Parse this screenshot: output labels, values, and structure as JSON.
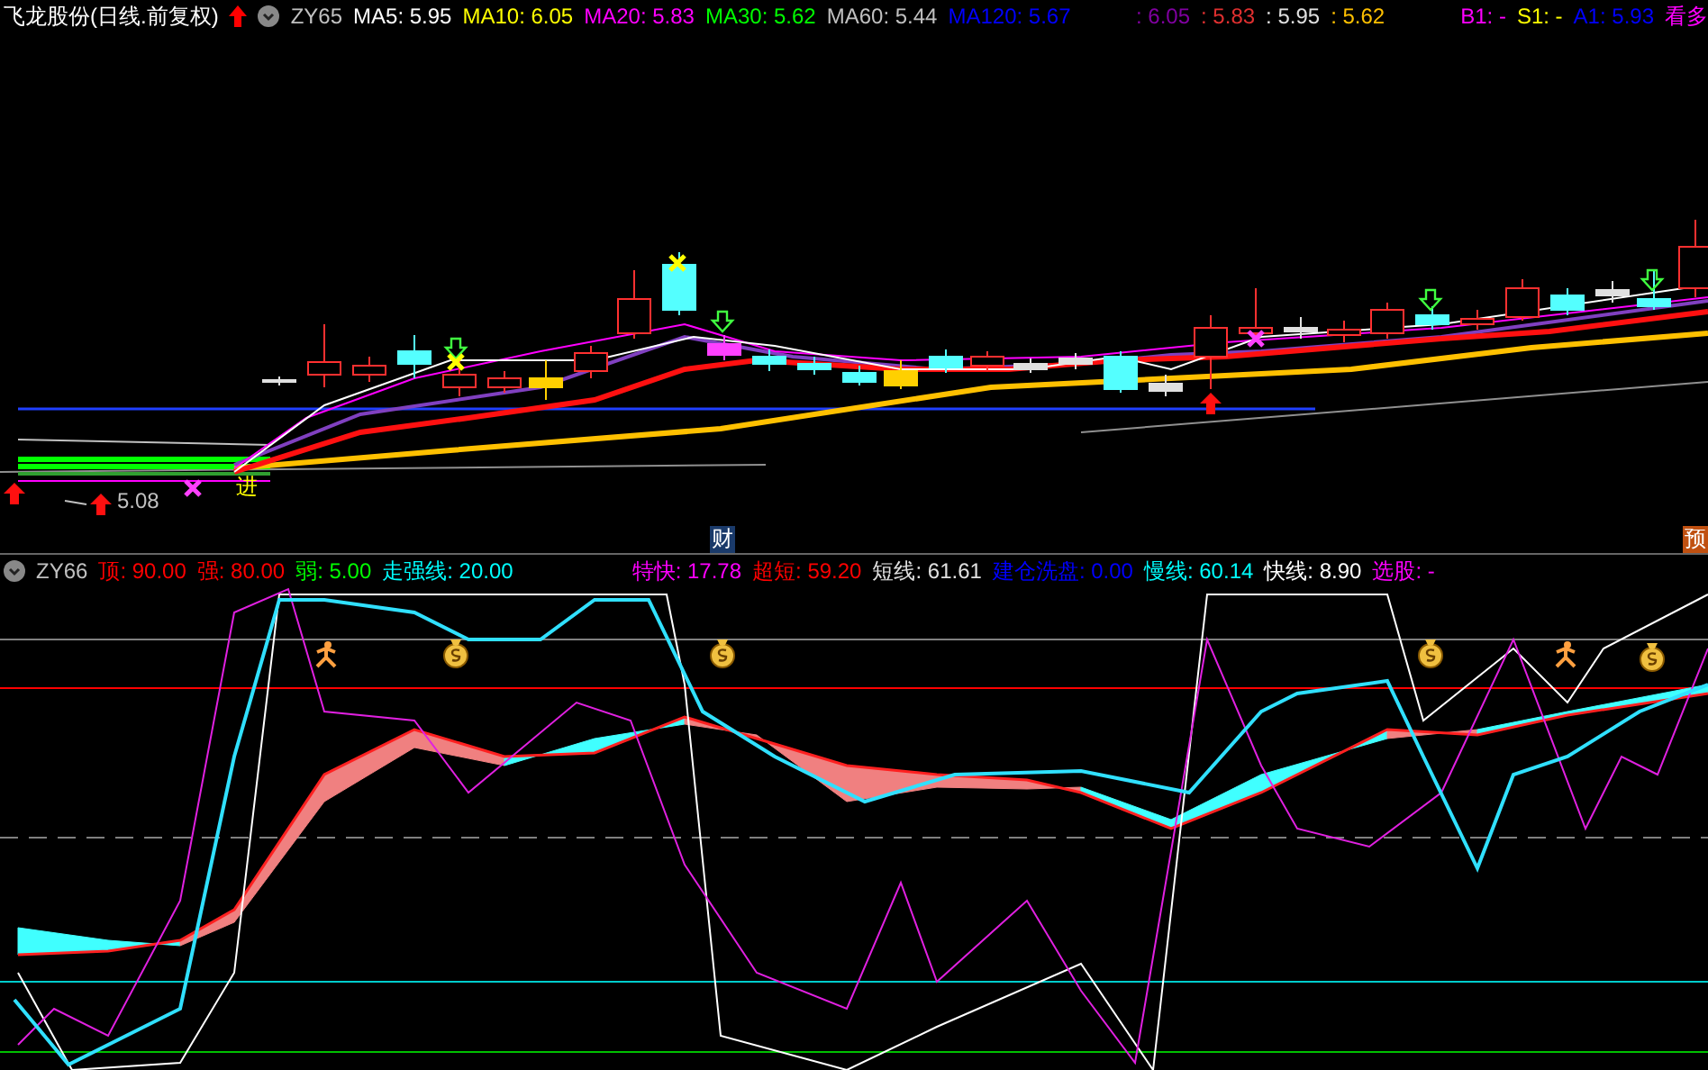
{
  "title": "飞龙股份(日线.前复权)",
  "top_indicator": {
    "name": "ZY65",
    "values": [
      {
        "text": "MA5: 5.95",
        "color": "#ffffff"
      },
      {
        "text": "MA10: 6.05",
        "color": "#ffff00"
      },
      {
        "text": "MA20: 5.83",
        "color": "#ff00ff"
      },
      {
        "text": "MA30: 5.62",
        "color": "#00ff00"
      },
      {
        "text": "MA60: 5.44",
        "color": "#c0c0c0"
      },
      {
        "text": "MA120: 5.67",
        "color": "#0000ff"
      }
    ],
    "extra_values": [
      {
        "text": ": 6.05",
        "color": "#8000a0"
      },
      {
        "text": ": 5.83",
        "color": "#e03030"
      },
      {
        "text": ": 5.95",
        "color": "#e0e0e0"
      },
      {
        "text": ": 5.62",
        "color": "#ffc000"
      }
    ],
    "signals": [
      {
        "text": "B1: -",
        "color": "#ff00ff"
      },
      {
        "text": "S1: -",
        "color": "#ffff00"
      },
      {
        "text": "A1: 5.93",
        "color": "#0000ff"
      },
      {
        "text": "看多",
        "color": "#ff00ff"
      }
    ]
  },
  "price_chart": {
    "low_label": "5.08",
    "entry_label": "进"
  },
  "event_markers": [
    {
      "text": "财",
      "kind": "finance"
    },
    {
      "text": "预",
      "kind": "forecast"
    }
  ],
  "bottom_indicator": {
    "name": "ZY66",
    "values": [
      {
        "text": "顶: 90.00",
        "color": "#ff0000"
      },
      {
        "text": "强: 80.00",
        "color": "#ff0000"
      },
      {
        "text": "弱: 5.00",
        "color": "#00ff00"
      },
      {
        "text": "走强线: 20.00",
        "color": "#00ffff"
      },
      {
        "text": "特快: 17.78",
        "color": "#ff00ff"
      },
      {
        "text": "超短: 59.20",
        "color": "#ff0000"
      },
      {
        "text": "短线: 61.61",
        "color": "#e0e0e0"
      },
      {
        "text": "建仓洗盘: 0.00",
        "color": "#0000ff"
      },
      {
        "text": "慢线: 60.14",
        "color": "#00ffff"
      },
      {
        "text": "快线: 8.90",
        "color": "#ffffff"
      },
      {
        "text": "选股: -",
        "color": "#ff00ff"
      }
    ]
  }
}
